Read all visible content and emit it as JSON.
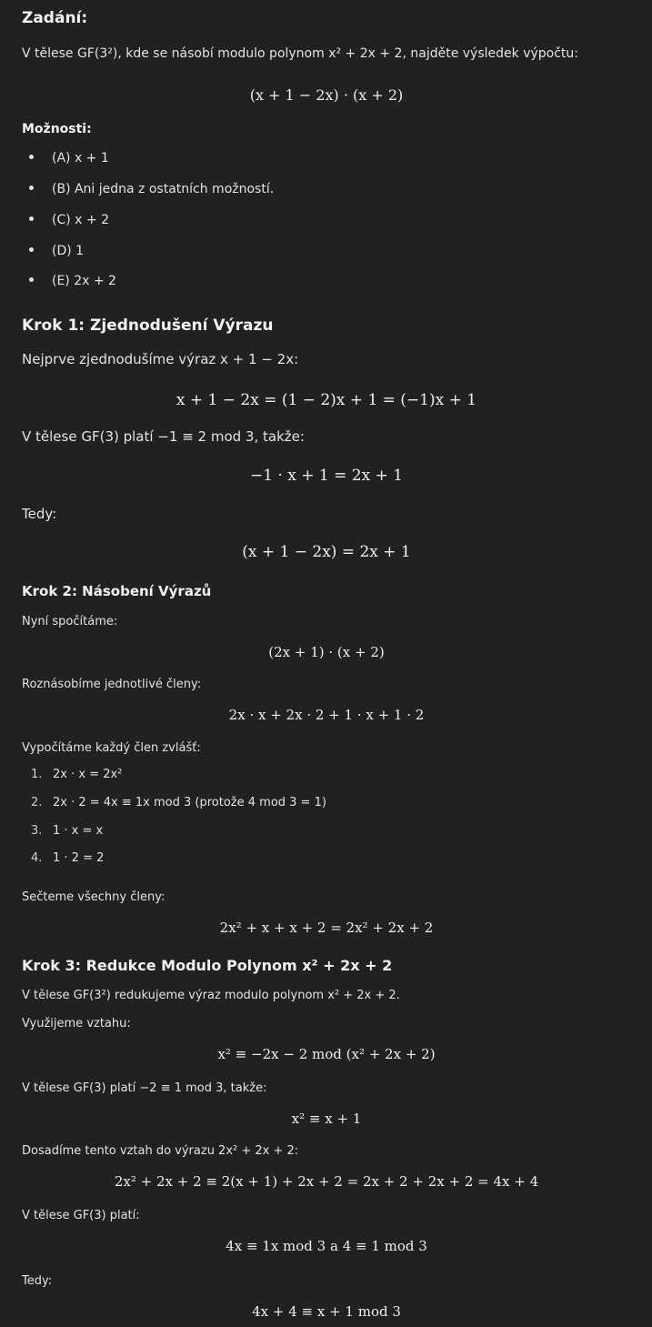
{
  "zadani": {
    "heading": "Zadání:",
    "intro": "V tělese GF(3²), kde se násobí modulo polynom x² + 2x + 2, najděte výsledek výpočtu:",
    "expr": "(x + 1 − 2x) · (x + 2)"
  },
  "moznosti": {
    "heading": "Možnosti:",
    "items": [
      "(A) x + 1",
      "(B) Ani jedna z ostatních možností.",
      "(C) x + 2",
      "(D) 1",
      "(E) 2x + 2"
    ]
  },
  "krok1": {
    "heading": "Krok 1: Zjednodušení Výrazu",
    "p1": "Nejprve zjednodušíme výraz x + 1 − 2x:",
    "eq1": "x + 1 − 2x = (1 − 2)x + 1 = (−1)x + 1",
    "p2": "V tělese GF(3) platí −1 ≡ 2  mod 3, takže:",
    "eq2": "−1 · x + 1 = 2x + 1",
    "p3": "Tedy:",
    "eq3": "(x + 1 − 2x) = 2x + 1"
  },
  "krok2": {
    "heading": "Krok 2: Násobení Výrazů",
    "p1": "Nyní spočítáme:",
    "eq1": "(2x + 1) · (x + 2)",
    "p2": "Roznásobíme jednotlivé členy:",
    "eq2": "2x · x + 2x · 2 + 1 · x + 1 · 2",
    "p3": "Vypočítáme každý člen zvlášť:",
    "list": [
      {
        "n": "1.",
        "text": "2x · x = 2x²"
      },
      {
        "n": "2.",
        "text": "2x · 2 = 4x ≡ 1x  mod 3 (protože 4  mod 3 = 1)"
      },
      {
        "n": "3.",
        "text": "1 · x = x"
      },
      {
        "n": "4.",
        "text": "1 · 2 = 2"
      }
    ],
    "p4": "Sečteme všechny členy:",
    "eq3": "2x² + x + x + 2 = 2x² + 2x + 2"
  },
  "krok3": {
    "heading": "Krok 3: Redukce Modulo Polynom x² + 2x + 2",
    "p1": "V tělese GF(3²) redukujeme výraz modulo polynom x² + 2x + 2.",
    "p2": "Využijeme vztahu:",
    "eq1": "x² ≡ −2x − 2  mod (x² + 2x + 2)",
    "p3": "V tělese GF(3) platí −2 ≡ 1  mod 3, takže:",
    "eq2": "x² ≡ x + 1",
    "p4": "Dosadíme tento vztah do výrazu 2x² + 2x + 2:",
    "eq3": "2x² + 2x + 2 ≡ 2(x + 1) + 2x + 2 = 2x + 2 + 2x + 2 = 4x + 4",
    "p5": "V tělese GF(3) platí:",
    "eq4": "4x ≡ 1x   mod 3   a   4 ≡ 1   mod 3",
    "p6": "Tedy:",
    "eq5": "4x + 4 ≡ x + 1   mod 3"
  }
}
